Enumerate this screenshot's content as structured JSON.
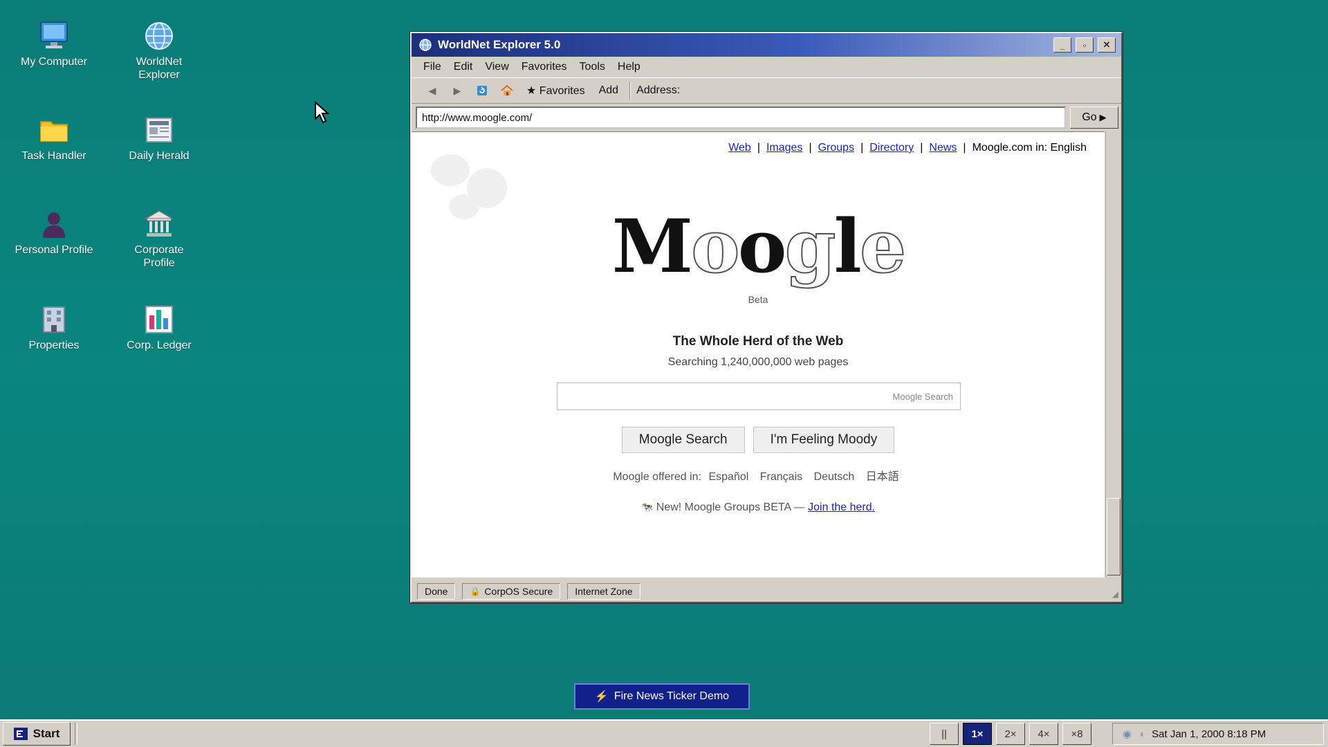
{
  "desktop": {
    "icons": [
      {
        "label": "My Computer",
        "icon": "monitor-icon"
      },
      {
        "label": "WorldNet Explorer",
        "icon": "globe-icon"
      },
      {
        "label": "Task Handler",
        "icon": "folder-icon"
      },
      {
        "label": "Daily Herald",
        "icon": "newspaper-icon"
      },
      {
        "label": "Personal Profile",
        "icon": "person-icon"
      },
      {
        "label": "Corporate Profile",
        "icon": "bank-icon"
      },
      {
        "label": "Properties",
        "icon": "building-icon"
      },
      {
        "label": "Corp. Ledger",
        "icon": "bar-chart-icon"
      }
    ]
  },
  "window": {
    "title": "WorldNet Explorer 5.0",
    "menu": [
      "File",
      "Edit",
      "View",
      "Favorites",
      "Tools",
      "Help"
    ],
    "toolbar": {
      "favorites": "★ Favorites",
      "add": "Add",
      "address_label": "Address:"
    },
    "address": "http://www.moogle.com/",
    "go": "Go",
    "status": {
      "done": "Done",
      "secure": "CorpOS Secure",
      "zone": "Internet Zone"
    }
  },
  "page": {
    "top_links": [
      "Web",
      "Images",
      "Groups",
      "Directory",
      "News"
    ],
    "locale_text": "Moogle.com in: English",
    "logo_letters": [
      "M",
      "o",
      "o",
      "g",
      "l",
      "e"
    ],
    "beta": "Beta",
    "tagline": "The Whole Herd of the Web",
    "subtag": "Searching 1,240,000,000 web pages",
    "search_hint": "Moogle Search",
    "btn_search": "Moogle Search",
    "btn_moody": "I'm Feeling Moody",
    "offered_label": "Moogle offered in:",
    "languages": [
      "Español",
      "Français",
      "Deutsch",
      "日本語"
    ],
    "new_text": "New! Moogle Groups BETA —",
    "join_link": "Join the herd."
  },
  "fire_button": "Fire News Ticker Demo",
  "taskbar": {
    "start": "Start",
    "speeds": [
      "||",
      "1×",
      "2×",
      "4×",
      "×8"
    ],
    "active_speed": "1×",
    "clock": "Sat Jan 1, 2000 8:18 PM"
  },
  "colors": {
    "desktop": "#0a807a",
    "titlebar": "#1b2f7c",
    "link": "#1a23c9",
    "fire_button": "#10218c"
  }
}
